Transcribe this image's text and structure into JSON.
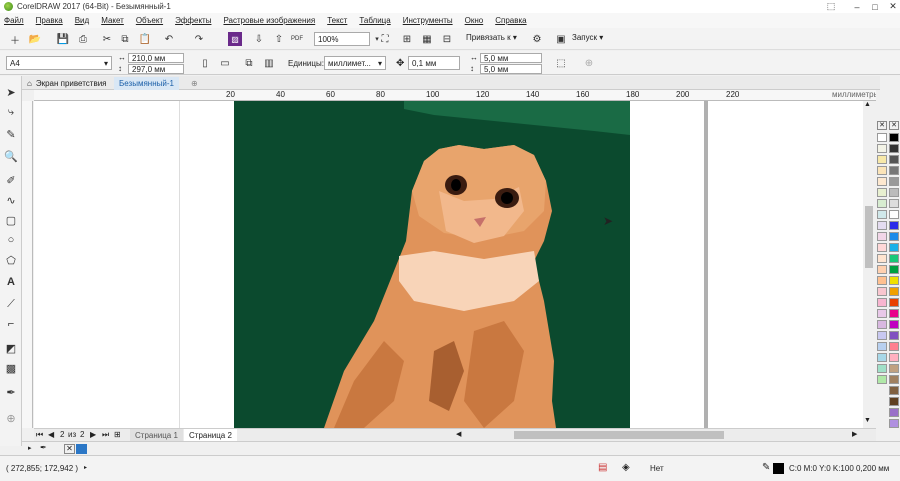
{
  "window": {
    "title": "CorelDRAW 2017 (64-Bit) - Безымянный-1"
  },
  "menu": [
    "Файл",
    "Правка",
    "Вид",
    "Макет",
    "Объект",
    "Эффекты",
    "Растровые изображения",
    "Текст",
    "Таблица",
    "Инструменты",
    "Окно",
    "Справка"
  ],
  "toolbar": {
    "zoom": "100%",
    "snap_label": "Привязать к",
    "launch_label": "Запуск"
  },
  "property_bar": {
    "page_size": "A4",
    "width": "210,0 мм",
    "height": "297,0 мм",
    "units_label": "Единицы:",
    "units_value": "миллимет...",
    "nudge": "0,1 мм",
    "dup_x": "5,0 мм",
    "dup_y": "5,0 мм"
  },
  "tabs": {
    "welcome": "Экран приветствия",
    "document": "Безымянный-1"
  },
  "ruler": {
    "ticks": [
      "20",
      "",
      "40",
      "60",
      "80",
      "100",
      "120",
      "140",
      "160",
      "180",
      "200",
      "220"
    ],
    "unit": "миллиметры"
  },
  "pages": {
    "current": "2",
    "of_label": "из",
    "total": "2",
    "tab1": "Страница 1",
    "tab2": "Страница 2"
  },
  "status": {
    "coords": "( 272,855; 172,942 )",
    "fill_label": "Нет",
    "outline_info": "C:0 M:0 Y:0 K:100  0,200 мм"
  },
  "colors": {
    "background": "#0b4a2e",
    "accent": "#2b77c6"
  },
  "palette_left": [
    "#ffffff",
    "#f3f3e6",
    "#f7e8a8",
    "#fbe4b8",
    "#fde8cf",
    "#e8f0d0",
    "#d7ecd0",
    "#d0e8ea",
    "#e4dcf0",
    "#f2d6e8",
    "#ffd8d8",
    "#ffe4d0",
    "#ffd0b0",
    "#ffc090",
    "#f9c6cf",
    "#f8b5d0",
    "#e8c8e8",
    "#d8b8e0",
    "#c8c8f0",
    "#b8d0f0",
    "#a8d8e8",
    "#a0e0c8",
    "#b0e8a8"
  ],
  "palette_right": [
    "#000000",
    "#333333",
    "#555555",
    "#777777",
    "#999999",
    "#bbbbbb",
    "#dddddd",
    "#ffffff",
    "#2a2ae8",
    "#1a8ae8",
    "#18b0e8",
    "#18c878",
    "#00a040",
    "#f0e000",
    "#f0a000",
    "#e84000",
    "#e8008a",
    "#c000c0",
    "#8050c0",
    "#ff8090",
    "#ffb0c0",
    "#c0a080",
    "#a08060",
    "#806040",
    "#604020",
    "#9a70c8",
    "#b090e0"
  ]
}
